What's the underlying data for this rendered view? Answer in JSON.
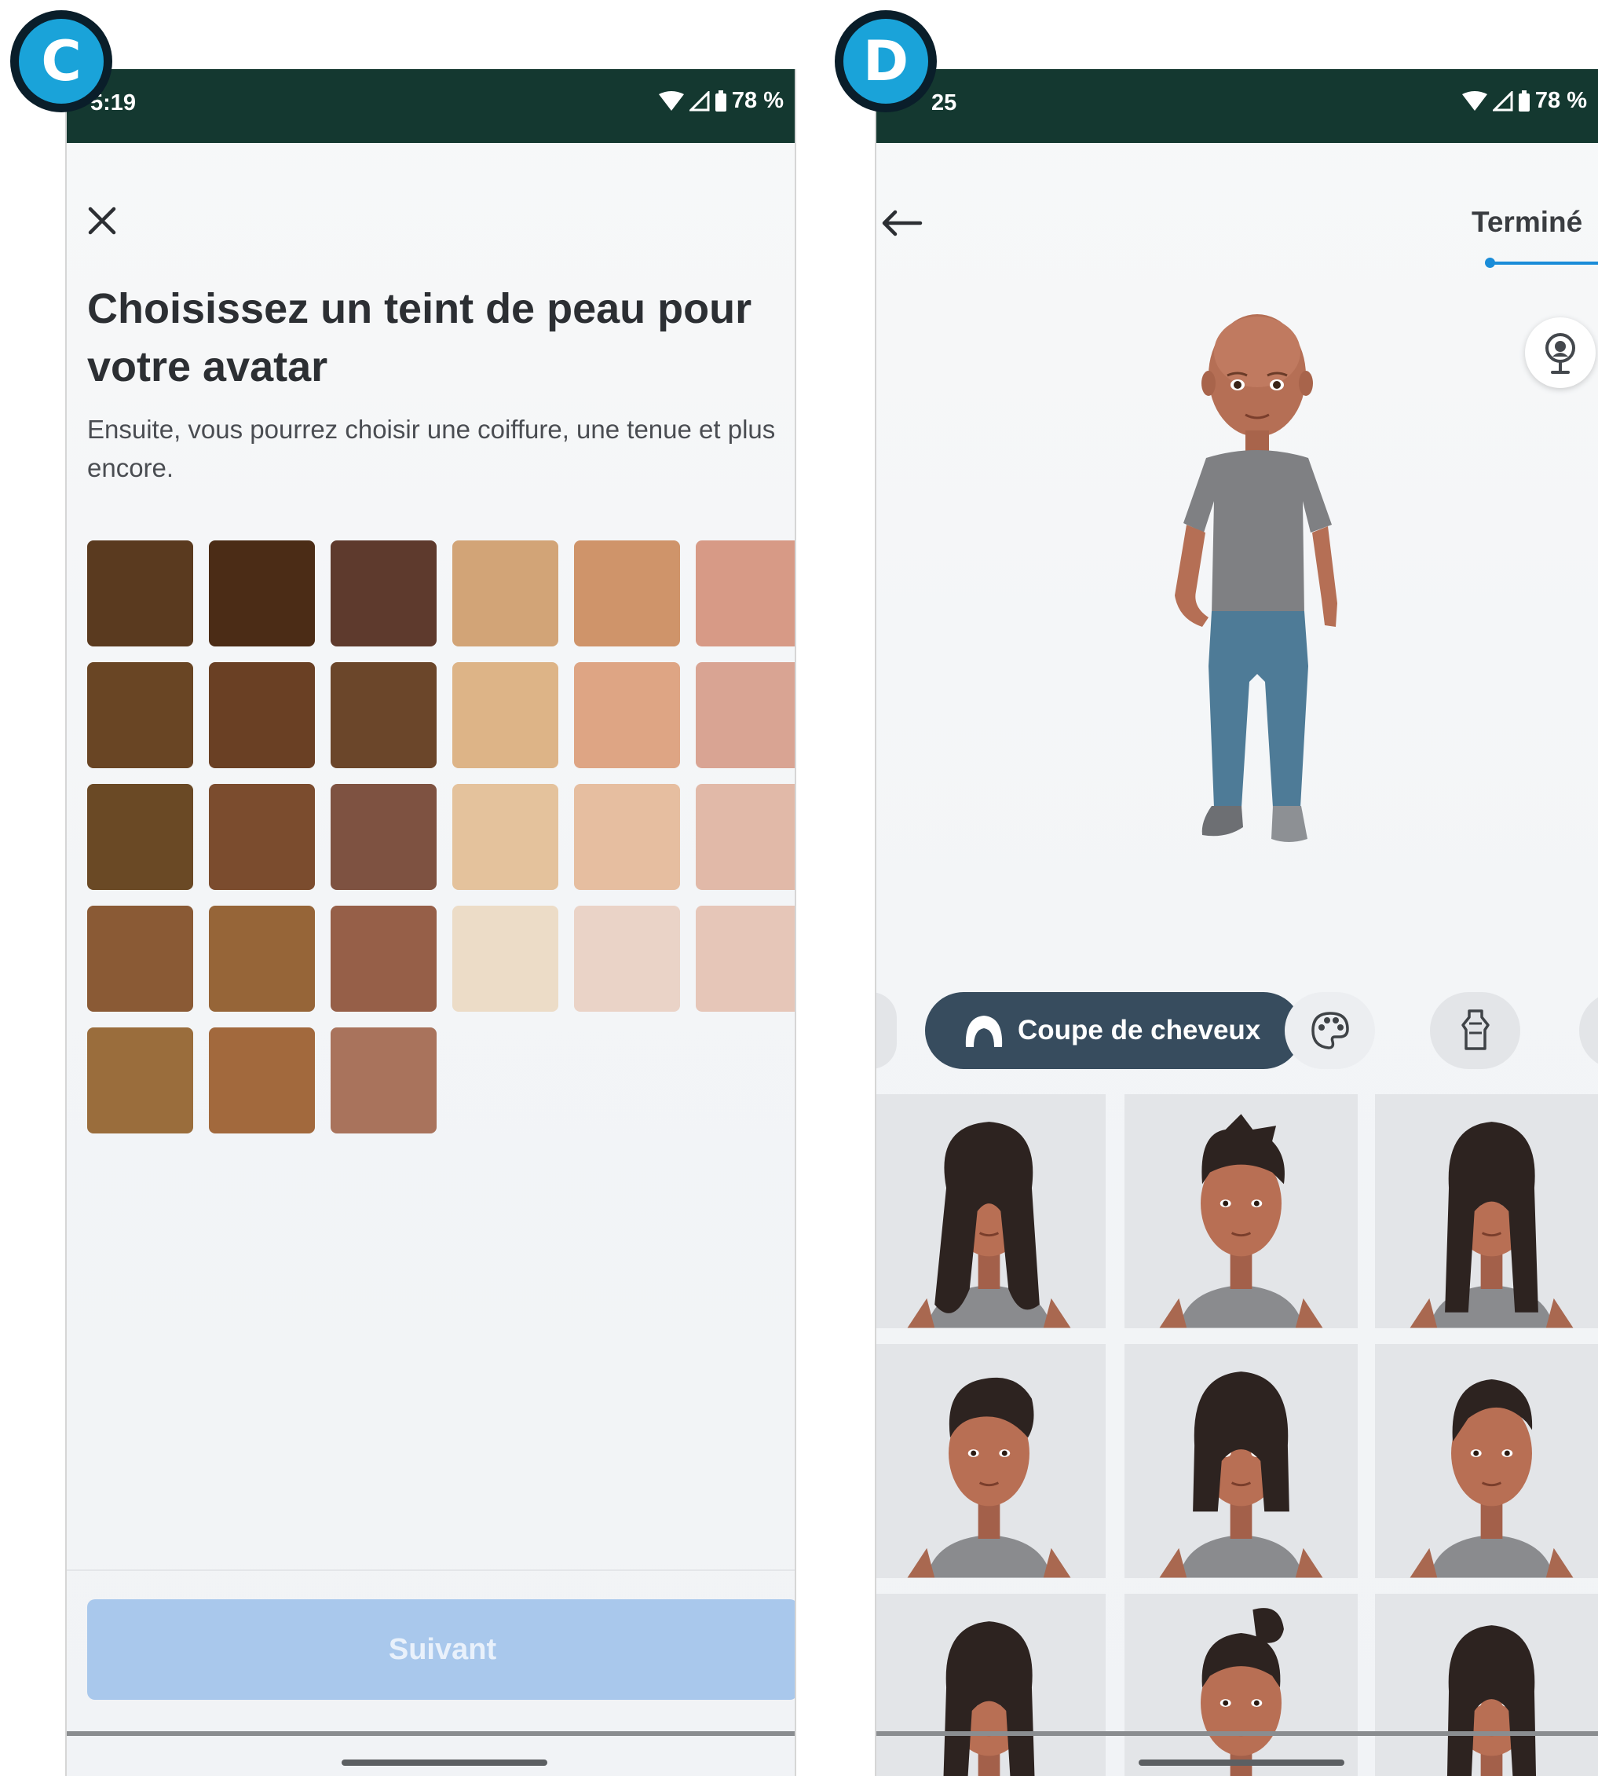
{
  "badges": {
    "left": "C",
    "right": "D"
  },
  "screen_c": {
    "status_time": "5:19",
    "status_battery": "78 %",
    "title": "Choisissez un teint de peau pour votre avatar",
    "subtitle": "Ensuite, vous pourrez choisir une coiffure, une tenue et plus encore.",
    "skin_tones": [
      [
        "#5a3a1f",
        "#4b2c16",
        "#5e3a2d",
        "#d2a477",
        "#cf946a",
        "#d79a86"
      ],
      [
        "#694524",
        "#6a4024",
        "#6b462a",
        "#ddb487",
        "#dea584",
        "#d9a493"
      ],
      [
        "#6a4925",
        "#7b4c2e",
        "#7e5241",
        "#e4c29c",
        "#e6bea0",
        "#e1b9a8"
      ],
      [
        "#8a5a35",
        "#966538",
        "#965f48",
        "#ecdcc7",
        "#ead3c7",
        "#e6c6b8"
      ],
      [
        "#9a6d3c",
        "#a2693d",
        "#a9735c"
      ]
    ],
    "next_button": "Suivant"
  },
  "screen_d": {
    "status_time": "25",
    "status_battery": "78 %",
    "done_label": "Terminé",
    "category_active": "Coupe de cheveux",
    "icons": {
      "back": "back-arrow-icon",
      "mirror": "mirror-icon",
      "hair": "hair-icon",
      "palette": "palette-icon",
      "outfit": "outfit-icon"
    },
    "hairstyles": [
      "long-wavy",
      "short-spiky",
      "long-straight",
      "short-quiff",
      "bob",
      "short-side",
      "long-straight",
      "bun",
      "long-side"
    ]
  },
  "colors": {
    "status_bar": "#143830",
    "primary_disabled": "#a9c8ec",
    "chip_active": "#374c5e",
    "accent": "#1a8cd8",
    "badge": "#1aa3d9"
  }
}
